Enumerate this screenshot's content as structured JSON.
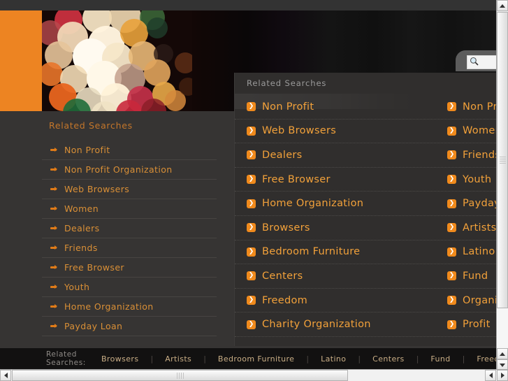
{
  "banner": {
    "accent_color": "#ed8422",
    "background_color": "#0a0607",
    "image_alt": "bokeh-lights-photo"
  },
  "search": {
    "icon": "magnifier-icon",
    "value": "",
    "placeholder": ""
  },
  "sidebar": {
    "title": "Related Searches",
    "bullet_icon": "arrow-bullet-icon",
    "items": [
      {
        "label": "Non Profit"
      },
      {
        "label": "Non Profit Organization"
      },
      {
        "label": "Web Browsers"
      },
      {
        "label": "Women"
      },
      {
        "label": "Dealers"
      },
      {
        "label": "Friends"
      },
      {
        "label": "Free Browser"
      },
      {
        "label": "Youth"
      },
      {
        "label": "Home Organization"
      },
      {
        "label": "Payday Loan"
      }
    ]
  },
  "overlay": {
    "title": "Related Searches",
    "icon": "chevron-right-badge-icon",
    "icon_glyph": "❯",
    "rows": [
      {
        "left": "Non Profit",
        "right": "Non Profit Organization"
      },
      {
        "left": "Web Browsers",
        "right": "Women"
      },
      {
        "left": "Dealers",
        "right": "Friends"
      },
      {
        "left": "Free Browser",
        "right": "Youth"
      },
      {
        "left": "Home Organization",
        "right": "Payday Loan"
      },
      {
        "left": "Browsers",
        "right": "Artists"
      },
      {
        "left": "Bedroom Furniture",
        "right": "Latino"
      },
      {
        "left": "Centers",
        "right": "Fund"
      },
      {
        "left": "Freedom",
        "right": "Organization"
      },
      {
        "left": "Charity Organization",
        "right": "Profit"
      }
    ]
  },
  "footer": {
    "title": "Related Searches:",
    "separator": "|",
    "links": [
      {
        "label": "Browsers"
      },
      {
        "label": "Artists"
      },
      {
        "label": "Bedroom Furniture"
      },
      {
        "label": "Latino"
      },
      {
        "label": "Centers"
      },
      {
        "label": "Fund"
      },
      {
        "label": "Freedom"
      }
    ]
  },
  "scrollbars": {
    "vertical": {
      "up": "▲",
      "down": "▼"
    },
    "horizontal": {
      "left": "◀",
      "right": "▶"
    }
  }
}
